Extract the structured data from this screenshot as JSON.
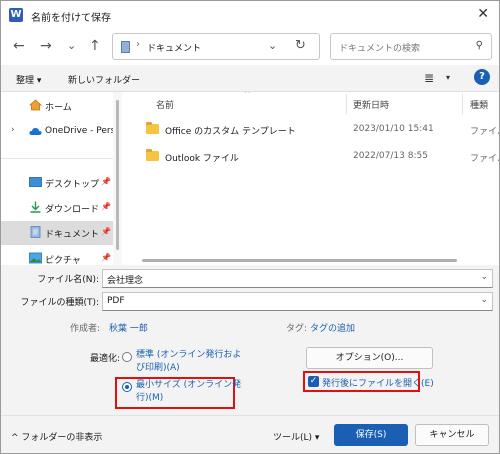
{
  "window": {
    "title": "名前を付けて保存",
    "app_icon_letter": "W",
    "close_glyph": "✕"
  },
  "nav": {
    "back": "←",
    "forward": "→",
    "recent": "⌄",
    "up": "↑",
    "address_sep": "›",
    "address_path": "ドキュメント",
    "address_dropdown": "⌄",
    "refresh": "↻",
    "search_placeholder": "ドキュメントの検索",
    "search_glyph": "⚲"
  },
  "toolbar": {
    "organize": "整理 ▾",
    "new_folder": "新しいフォルダー",
    "view_glyph": "≣",
    "view_dd": "▾",
    "help_glyph": "?"
  },
  "sidebar": {
    "items": [
      {
        "label": "ホーム",
        "icon": "home-icon"
      },
      {
        "label": "OneDrive - Perso",
        "icon": "cloud-icon",
        "chevron": "›"
      },
      {
        "label": "デスクトップ",
        "icon": "desktop-icon",
        "pin": "📌"
      },
      {
        "label": "ダウンロード",
        "icon": "download-icon",
        "pin": "📌"
      },
      {
        "label": "ドキュメント",
        "icon": "documents-icon",
        "pin": "📌"
      },
      {
        "label": "ピクチャ",
        "icon": "pictures-icon",
        "pin": "📌"
      }
    ]
  },
  "filelist": {
    "headers": {
      "name": "名前",
      "modified": "更新日時",
      "type": "種類"
    },
    "sort_glyph": "^",
    "rows": [
      {
        "name": "Office のカスタム テンプレート",
        "modified": "2023/01/10 15:41",
        "type": "ファイル"
      },
      {
        "name": "Outlook ファイル",
        "modified": "2022/07/13 8:55",
        "type": "ファイル"
      }
    ]
  },
  "form": {
    "filename_label": "ファイル名(N):",
    "filename_value": "会社理念",
    "filetype_label": "ファイルの種類(T):",
    "filetype_value": "PDF",
    "dd_glyph": "⌄",
    "author_label": "作成者:",
    "author_value": "秋葉 一郎",
    "tag_label": "タグ:",
    "tag_value": "タグの追加",
    "optimize_label": "最適化:",
    "opt_standard_line1": "標準 (オンライン発行およ",
    "opt_standard_line2": "び印刷)(A)",
    "opt_min_line1": "最小サイズ (オンライン発",
    "opt_min_line2": "行)(M)",
    "options_button": "オプション(O)...",
    "open_after_publish": "発行後にファイルを開く(E)",
    "check_glyph": "✓"
  },
  "footer": {
    "hide_folders": "^ フォルダーの非表示",
    "tools": "ツール(L)  ▾",
    "save": "保存(S)",
    "cancel": "キャンセル"
  },
  "colors": {
    "accent": "#1a5fb4",
    "highlight_box": "#e01010"
  }
}
